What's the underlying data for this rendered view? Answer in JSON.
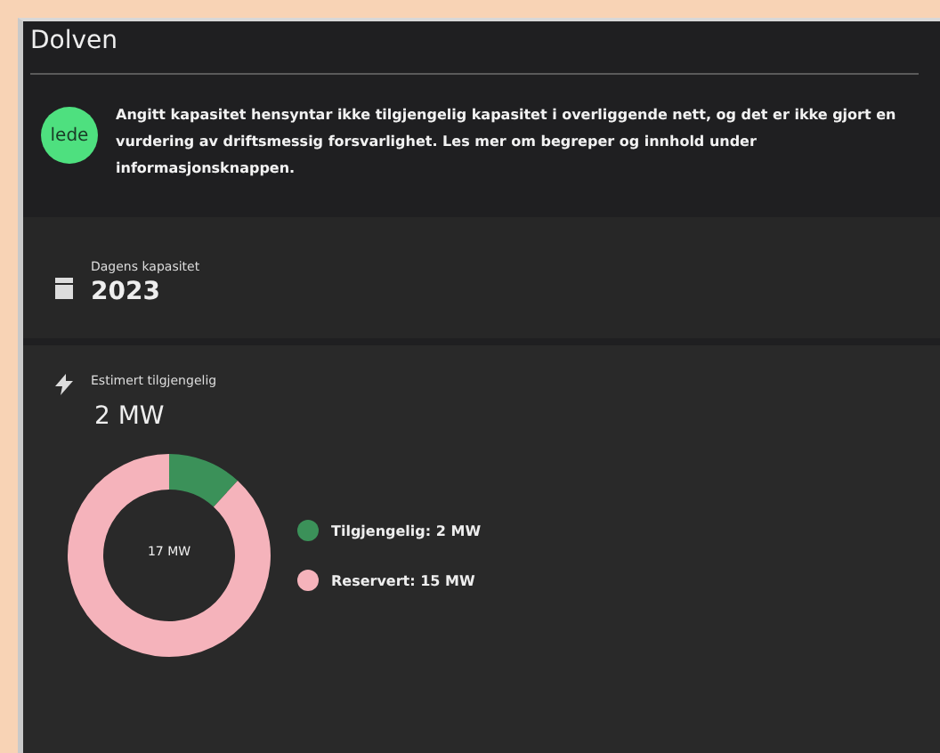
{
  "window": {
    "title": "Dolven"
  },
  "notice": {
    "badge": "lede",
    "text": "Angitt kapasitet hensyntar ikke tilgjengelig kapasitet i overliggende nett, og det er ikke gjort en vurdering av driftsmessig forsvarlighet. Les mer om begreper og innhold under informasjonsknappen."
  },
  "capacity": {
    "label": "Dagens kapasitet",
    "value": "2023"
  },
  "estimate": {
    "label": "Estimert tilgjengelig",
    "value": "2 MW",
    "center_label": "17 MW",
    "legend": [
      {
        "label": "Tilgjengelig: 2 MW",
        "color": "#3b9159"
      },
      {
        "label": "Reservert: 15 MW",
        "color": "#f5b3bb"
      }
    ],
    "chart_data": {
      "type": "donut",
      "values": [
        11.8,
        88.2
      ]
    }
  }
}
